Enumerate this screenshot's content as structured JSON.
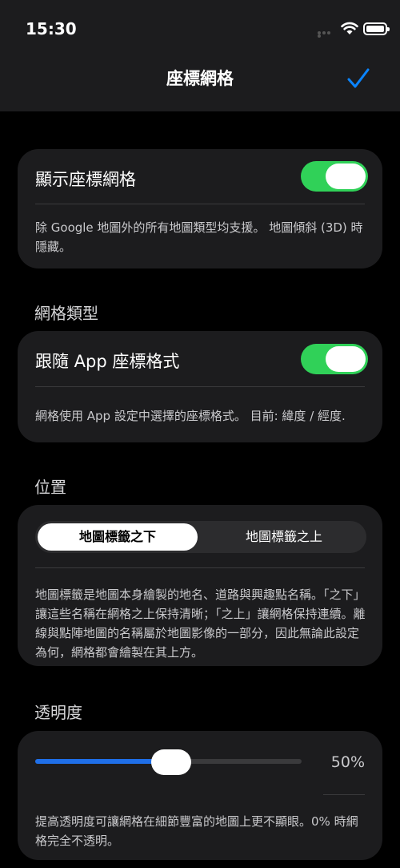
{
  "status_bar": {
    "time": "15:30"
  },
  "nav": {
    "title": "座標網格",
    "done_icon": "checkmark-icon"
  },
  "colors": {
    "accent": "#0a84ff",
    "toggle_on": "#30d158",
    "card": "#1c1c1e",
    "slider_fill": "#1f6fe8"
  },
  "show_grid": {
    "label": "顯示座標網格",
    "enabled": true,
    "note": "除 Google 地圖外的所有地圖類型均支援。 地圖傾斜 (3D) 時隱藏。"
  },
  "grid_type": {
    "section_title": "網格類型",
    "label": "跟隨 App 座標格式",
    "enabled": true,
    "note": "網格使用 App 設定中選擇的座標格式。 目前: 緯度 / 經度."
  },
  "position": {
    "section_title": "位置",
    "options": [
      "地圖標籤之下",
      "地圖標籤之上"
    ],
    "selected": "地圖標籤之下",
    "note": "地圖標籤是地圖本身繪製的地名、道路與興趣點名稱。「之下」讓這些名稱在網格之上保持清晰；「之上」讓網格保持連續。離線與點陣地圖的名稱屬於地圖影像的一部分，因此無論此設定為何，網格都會繪製在其上方。"
  },
  "transparency": {
    "section_title": "透明度",
    "value": 0.5,
    "value_label": "50%",
    "note": "提高透明度可讓網格在細節豐富的地圖上更不顯眼。0% 時網格完全不透明。"
  }
}
